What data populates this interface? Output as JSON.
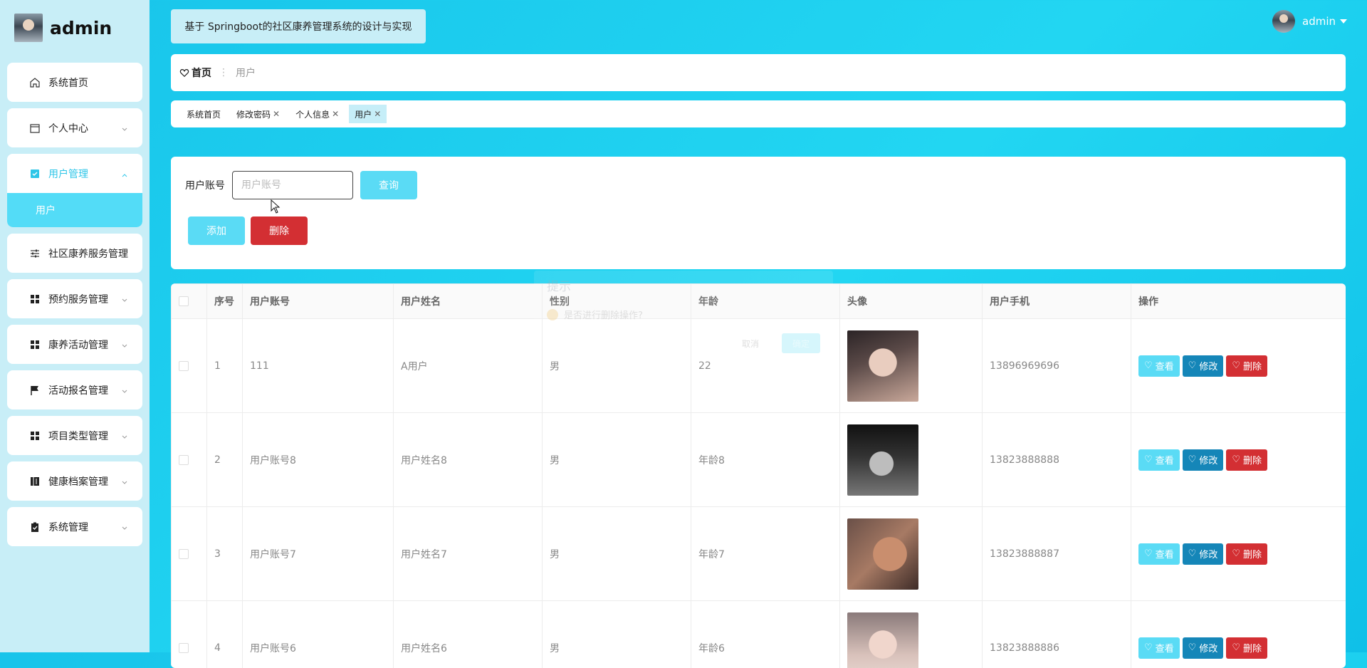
{
  "sidebar": {
    "brand": "admin",
    "items": [
      {
        "label": "系统首页",
        "icon": "home-icon"
      },
      {
        "label": "个人中心",
        "icon": "calendar-icon"
      },
      {
        "label": "用户管理",
        "icon": "check-square-icon",
        "sub": [
          "用户"
        ]
      },
      {
        "label": "社区康养服务管理",
        "icon": "sliders-icon"
      },
      {
        "label": "预约服务管理",
        "icon": "grid-icon"
      },
      {
        "label": "康养活动管理",
        "icon": "grid-icon"
      },
      {
        "label": "活动报名管理",
        "icon": "flag-icon"
      },
      {
        "label": "项目类型管理",
        "icon": "grid-icon"
      },
      {
        "label": "健康档案管理",
        "icon": "book-icon"
      },
      {
        "label": "系统管理",
        "icon": "clipboard-icon"
      }
    ]
  },
  "header": {
    "title": "基于 Springboot的社区康养管理系统的设计与实现",
    "user": "admin"
  },
  "breadcrumb": {
    "home": "首页",
    "current": "用户"
  },
  "tabs": [
    {
      "label": "系统首页",
      "closable": false,
      "active": false
    },
    {
      "label": "修改密码",
      "closable": true,
      "active": false
    },
    {
      "label": "个人信息",
      "closable": true,
      "active": false
    },
    {
      "label": "用户",
      "closable": true,
      "active": true
    }
  ],
  "search": {
    "label": "用户账号",
    "placeholder": "用户账号",
    "query_btn": "查询",
    "add_btn": "添加",
    "delete_btn": "删除"
  },
  "table": {
    "headers": [
      "序号",
      "用户账号",
      "用户姓名",
      "性别",
      "年龄",
      "头像",
      "用户手机",
      "操作"
    ],
    "rows": [
      {
        "no": "1",
        "account": "111",
        "name": "A用户",
        "gender": "男",
        "age": "22",
        "phone": "13896969696"
      },
      {
        "no": "2",
        "account": "用户账号8",
        "name": "用户姓名8",
        "gender": "男",
        "age": "年龄8",
        "phone": "13823888888"
      },
      {
        "no": "3",
        "account": "用户账号7",
        "name": "用户姓名7",
        "gender": "男",
        "age": "年龄7",
        "phone": "13823888887"
      },
      {
        "no": "4",
        "account": "用户账号6",
        "name": "用户姓名6",
        "gender": "男",
        "age": "年龄6",
        "phone": "13823888886"
      }
    ],
    "actions": {
      "view": "查看",
      "edit": "修改",
      "delete": "删除"
    }
  },
  "dialog": {
    "title": "提示",
    "message": "是否进行删除操作?",
    "cancel": "取消",
    "confirm": "确定"
  },
  "colors": {
    "accent": "#5adbf5",
    "edit": "#1586b8",
    "danger": "#d32f33",
    "sidebar_bg": "#c8eef7"
  }
}
